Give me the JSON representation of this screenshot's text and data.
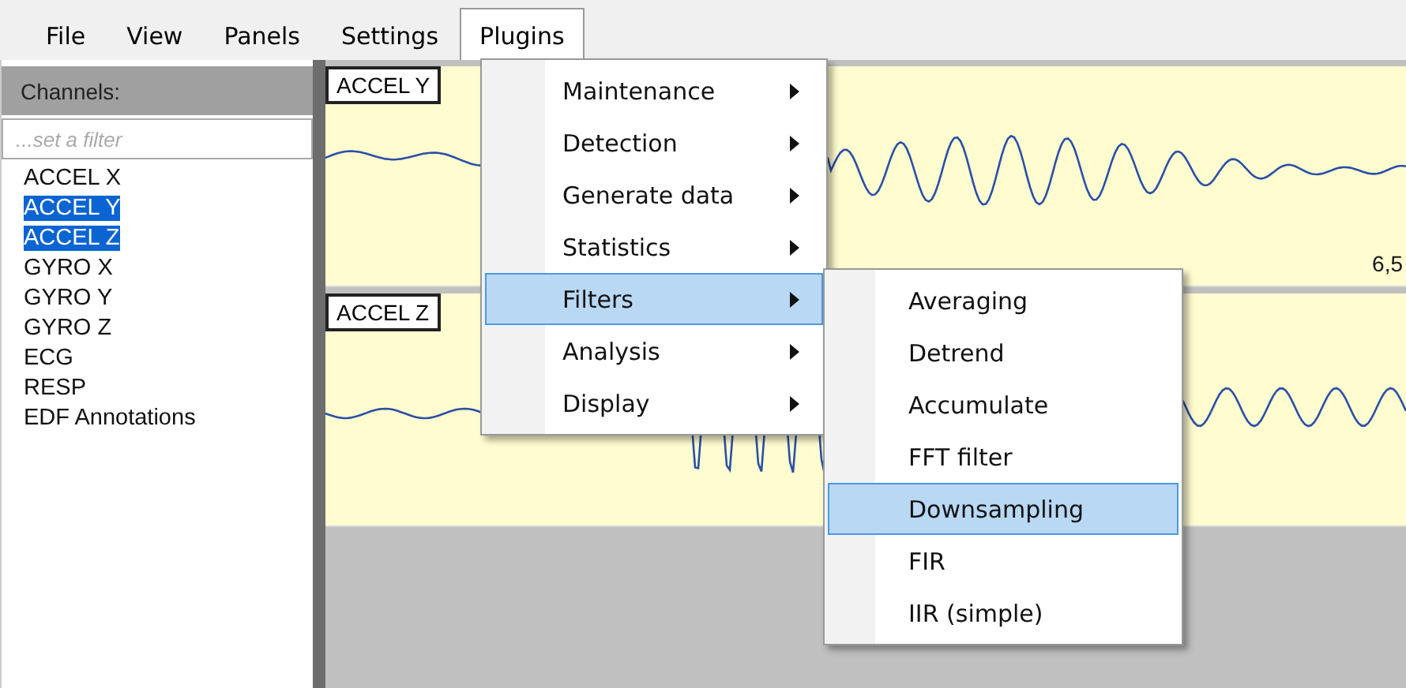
{
  "menu_bar": [
    {
      "label": "File",
      "selected": false
    },
    {
      "label": "View",
      "selected": false
    },
    {
      "label": "Panels",
      "selected": false
    },
    {
      "label": "Settings",
      "selected": false
    },
    {
      "label": "Plugins",
      "selected": true
    }
  ],
  "channels_panel": {
    "title": "Channels:",
    "filter": {
      "placeholder": "...set a filter"
    },
    "items": [
      {
        "label": "ACCEL X",
        "selected": false
      },
      {
        "label": "ACCEL Y",
        "selected": true
      },
      {
        "label": "ACCEL Z",
        "selected": true
      },
      {
        "label": "GYRO X",
        "selected": false
      },
      {
        "label": "GYRO Y",
        "selected": false
      },
      {
        "label": "GYRO Z",
        "selected": false
      },
      {
        "label": "ECG",
        "selected": false
      },
      {
        "label": "RESP",
        "selected": false
      },
      {
        "label": "EDF Annotations",
        "selected": false
      }
    ]
  },
  "plots": [
    {
      "label": "ACCEL Y",
      "tick_label": "6,5"
    },
    {
      "label": "ACCEL Z"
    }
  ],
  "plugins_menu": {
    "items": [
      {
        "label": "Maintenance",
        "selected": false
      },
      {
        "label": "Detection",
        "selected": false
      },
      {
        "label": "Generate data",
        "selected": false
      },
      {
        "label": "Statistics",
        "selected": false
      },
      {
        "label": "Filters",
        "selected": true
      },
      {
        "label": "Analysis",
        "selected": false
      },
      {
        "label": "Display",
        "selected": false
      }
    ]
  },
  "filters_submenu": {
    "items": [
      {
        "label": "Averaging",
        "selected": false
      },
      {
        "label": "Detrend",
        "selected": false
      },
      {
        "label": "Accumulate",
        "selected": false
      },
      {
        "label": "FFT filter",
        "selected": false
      },
      {
        "label": "Downsampling",
        "selected": true
      },
      {
        "label": "FIR",
        "selected": false
      },
      {
        "label": "IIR (simple)",
        "selected": false
      }
    ]
  }
}
